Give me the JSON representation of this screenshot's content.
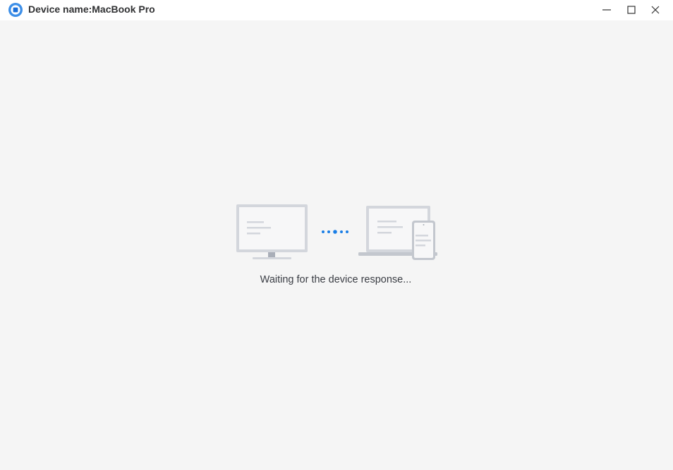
{
  "window": {
    "title": "Device name:MacBook Pro",
    "app_icon": "app-logo-icon",
    "controls": {
      "minimize": "minimize-icon",
      "maximize": "maximize-icon",
      "close": "close-icon"
    }
  },
  "main": {
    "status_text": "Waiting for the device response...",
    "illustration": {
      "left_device": "desktop-monitor-icon",
      "connector": "connecting-dots-icon",
      "right_devices": [
        "laptop-icon",
        "phone-icon"
      ]
    }
  },
  "colors": {
    "accent": "#1a7ee6",
    "titlebar_bg": "#ffffff",
    "content_bg": "#f5f5f5",
    "device_frame": "#d3d6dc",
    "device_screen": "#f7f7f8"
  }
}
